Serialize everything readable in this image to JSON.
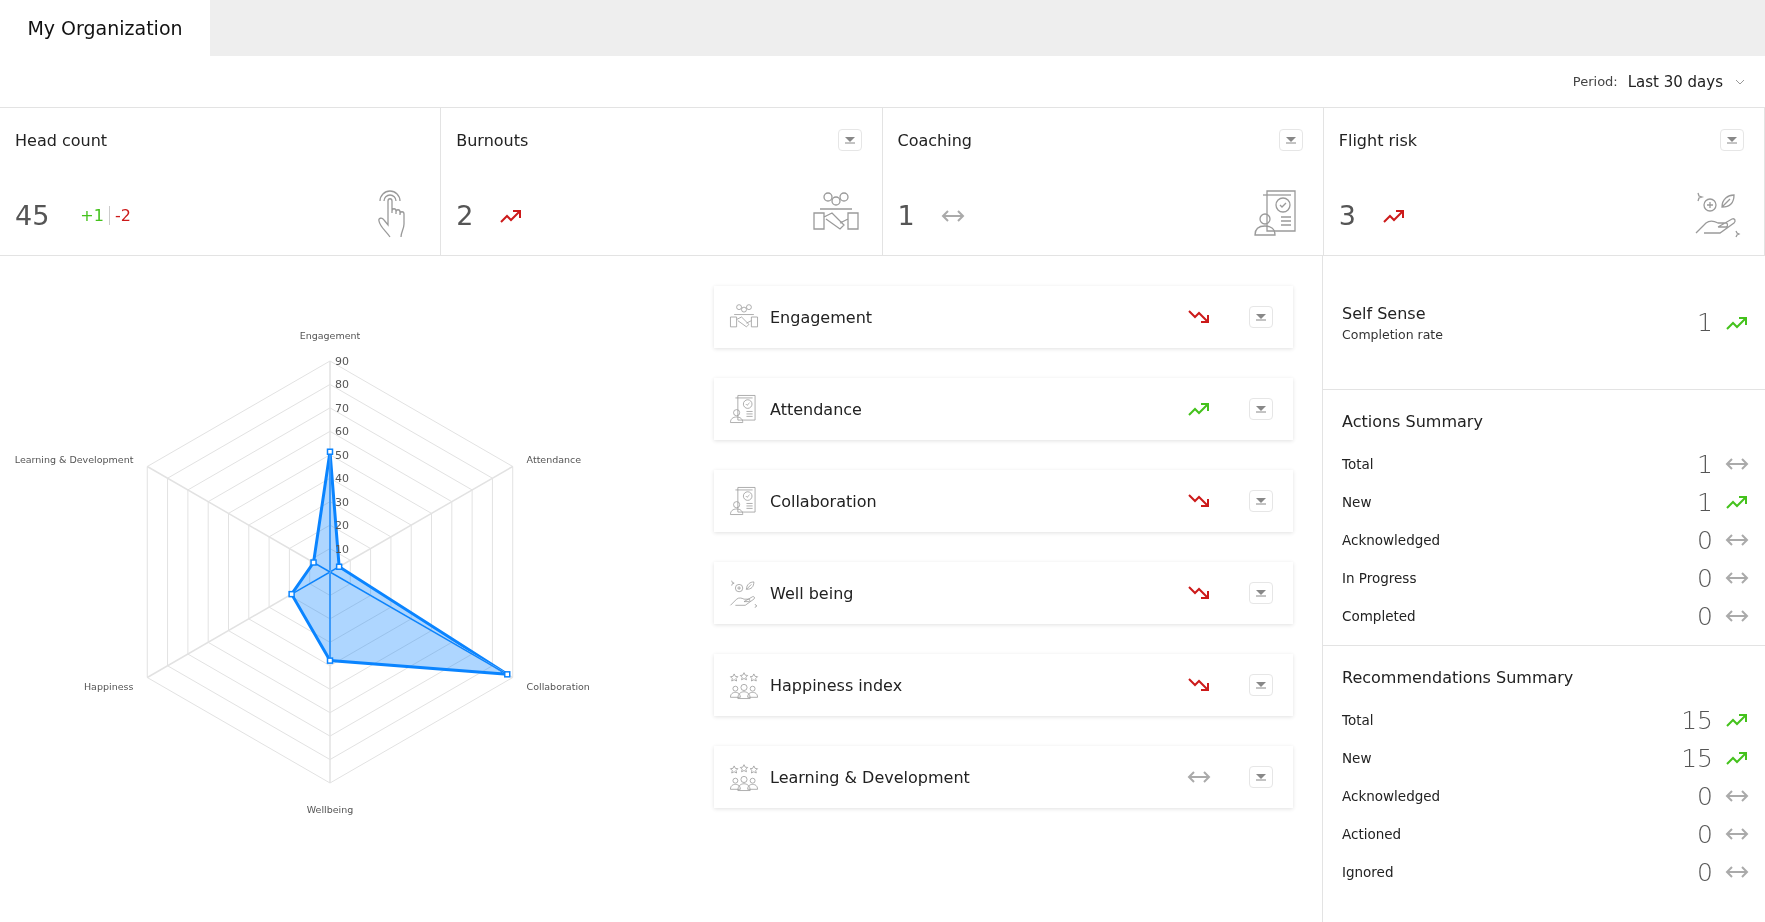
{
  "tabs": [
    {
      "label": "My Organization",
      "selected": true
    }
  ],
  "period": {
    "label": "Period:",
    "value": "Last 30 days"
  },
  "kpis": [
    {
      "title": "Head count",
      "value": "45",
      "menu": false,
      "icon": {
        "kind": "hand"
      },
      "deltas": [
        {
          "text": "+1",
          "kind": "increase"
        },
        {
          "text": "-2",
          "kind": "decrease"
        }
      ]
    },
    {
      "title": "Burnouts",
      "value": "2",
      "menu": true,
      "icon": {
        "kind": "team"
      },
      "trend": {
        "kind": "up",
        "color": "#cc1a1a"
      }
    },
    {
      "title": "Coaching",
      "value": "1",
      "menu": true,
      "icon": {
        "kind": "document"
      },
      "trend": {
        "kind": "flat",
        "color": "#aaaaaa"
      }
    },
    {
      "title": "Flight risk",
      "value": "3",
      "menu": true,
      "icon": {
        "kind": "care"
      },
      "trend": {
        "kind": "up",
        "color": "#cc1a1a"
      }
    }
  ],
  "radar": {
    "ticks": [
      "90",
      "80",
      "70",
      "60",
      "50",
      "40",
      "30",
      "20",
      "10"
    ],
    "axes": [
      {
        "label": "Engagement",
        "level": 0.57
      },
      {
        "label": "Attendance",
        "level": 0.05
      },
      {
        "label": "Collaboration",
        "level": 0.97
      },
      {
        "label": "Wellbeing",
        "level": 0.42
      },
      {
        "label": "Happiness",
        "level": 0.21
      },
      {
        "label": "Learning & Development",
        "level": 0.09
      }
    ]
  },
  "metrics": [
    {
      "label": "Engagement",
      "icon": {
        "kind": "team"
      },
      "trend": {
        "kind": "down",
        "color": "#cc1a1a"
      }
    },
    {
      "label": "Attendance",
      "icon": {
        "kind": "document"
      },
      "trend": {
        "kind": "up",
        "color": "#44c21c"
      }
    },
    {
      "label": "Collaboration",
      "icon": {
        "kind": "document"
      },
      "trend": {
        "kind": "down",
        "color": "#cc1a1a"
      }
    },
    {
      "label": "Well being",
      "icon": {
        "kind": "care"
      },
      "trend": {
        "kind": "down",
        "color": "#cc1a1a"
      }
    },
    {
      "label": "Happiness index",
      "icon": {
        "kind": "stars"
      },
      "trend": {
        "kind": "down",
        "color": "#cc1a1a"
      }
    },
    {
      "label": "Learning & Development",
      "icon": {
        "kind": "stars"
      },
      "trend": {
        "kind": "flat",
        "color": "#aaaaaa"
      }
    }
  ],
  "self_sense": {
    "title": "Self Sense",
    "subtitle": "Completion rate",
    "value": "1",
    "trend": {
      "kind": "up",
      "color": "#44c21c"
    }
  },
  "summaries": [
    {
      "title": "Actions Summary",
      "rows": [
        {
          "label": "Total",
          "value": "1",
          "trend": {
            "kind": "flat",
            "color": "#aaaaaa"
          }
        },
        {
          "label": "New",
          "value": "1",
          "trend": {
            "kind": "up",
            "color": "#44c21c"
          }
        },
        {
          "label": "Acknowledged",
          "value": "0",
          "trend": {
            "kind": "flat",
            "color": "#aaaaaa"
          }
        },
        {
          "label": "In Progress",
          "value": "0",
          "trend": {
            "kind": "flat",
            "color": "#aaaaaa"
          }
        },
        {
          "label": "Completed",
          "value": "0",
          "trend": {
            "kind": "flat",
            "color": "#aaaaaa"
          }
        }
      ]
    },
    {
      "title": "Recommendations Summary",
      "rows": [
        {
          "label": "Total",
          "value": "15",
          "trend": {
            "kind": "up",
            "color": "#44c21c"
          }
        },
        {
          "label": "New",
          "value": "15",
          "trend": {
            "kind": "up",
            "color": "#44c21c"
          }
        },
        {
          "label": "Acknowledged",
          "value": "0",
          "trend": {
            "kind": "flat",
            "color": "#aaaaaa"
          }
        },
        {
          "label": "Actioned",
          "value": "0",
          "trend": {
            "kind": "flat",
            "color": "#aaaaaa"
          }
        },
        {
          "label": "Ignored",
          "value": "0",
          "trend": {
            "kind": "flat",
            "color": "#aaaaaa"
          }
        }
      ]
    }
  ]
}
